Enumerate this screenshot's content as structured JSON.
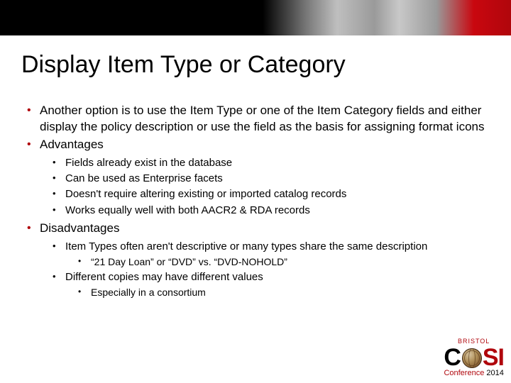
{
  "title": "Display Item Type or Category",
  "bullets": {
    "b1": "Another option is to use the Item Type or one of the Item Category fields and either display the policy description or use the field as the basis for assigning format icons",
    "b2": "Advantages",
    "b2_1": "Fields already exist in the database",
    "b2_2": "Can be used as Enterprise facets",
    "b2_3": "Doesn't require altering existing or imported catalog records",
    "b2_4": "Works equally well with both AACR2 & RDA records",
    "b3": "Disadvantages",
    "b3_1": "Item Types often aren't descriptive or many types share the same description",
    "b3_1_1": "“21 Day Loan” or “DVD” vs. “DVD-NOHOLD”",
    "b3_2": "Different copies may have different values",
    "b3_2_1": "Especially in a consortium"
  },
  "logo": {
    "top": "BRISTOL",
    "c": "C",
    "si": "SI",
    "bottom_word": "Conference ",
    "year": "2014"
  }
}
